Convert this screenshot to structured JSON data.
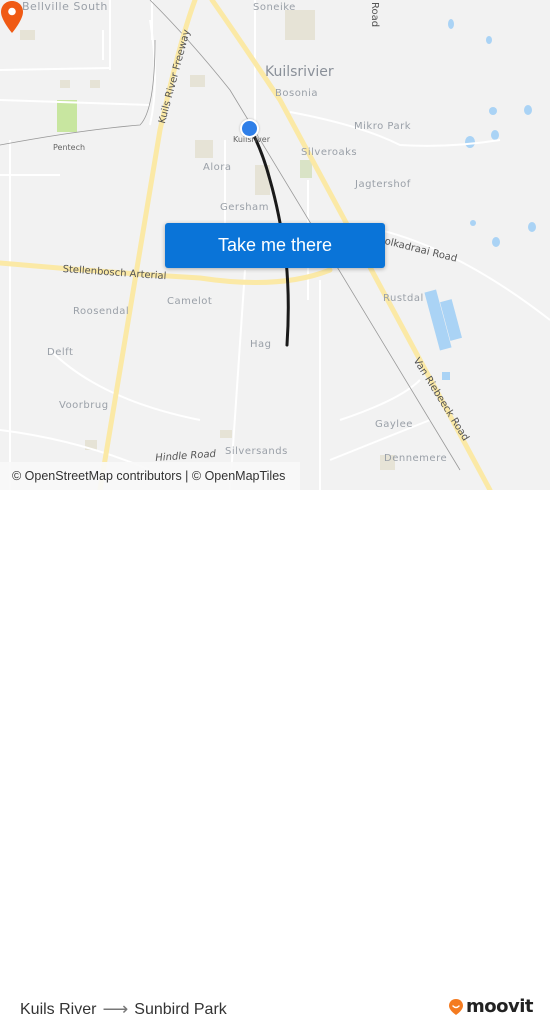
{
  "map": {
    "button_label": "Take me there",
    "attribution": "© OpenStreetMap contributors | © OpenMapTiles",
    "places": {
      "bellville_south": "Bellville South",
      "soneike": "Soneike",
      "kuilsrivier": "Kuilsrivier",
      "bosonia": "Bosonia",
      "mikro_park": "Mikro Park",
      "pentech": "Pentech",
      "kuilsriver_station": "Kuilsriver",
      "alora": "Alora",
      "silveroaks": "Silveroaks",
      "jagtershof": "Jagtershof",
      "gersham": "Gersham",
      "camelot": "Camelot",
      "roosendal": "Roosendal",
      "rustdal": "Rustdal",
      "delft": "Delft",
      "hag": "Hag",
      "voorbrug": "Voorbrug",
      "gaylee": "Gaylee",
      "dennemere": "Dennemere",
      "silversands": "Silversands"
    },
    "roads": {
      "kuils_river_freeway": "Kuils River Freeway",
      "road_top": "Road",
      "stellenbosch_arterial": "Stellenbosch Arterial",
      "bottelary": "olkadraai Road",
      "van_riebeeck": "Van Riebeeck Road",
      "hindle": "Hindle Road"
    },
    "colors": {
      "route": "#1a1a1a",
      "origin": "#2f7fe8",
      "destination": "#f05a14",
      "button": "#0a74d8",
      "major_road": "#fbe9a6",
      "water": "#aad3f5",
      "park": "#c8e6a0"
    }
  },
  "footer": {
    "origin": "Kuils River",
    "arrow": "⟶",
    "destination": "Sunbird Park",
    "brand": "moovit"
  }
}
